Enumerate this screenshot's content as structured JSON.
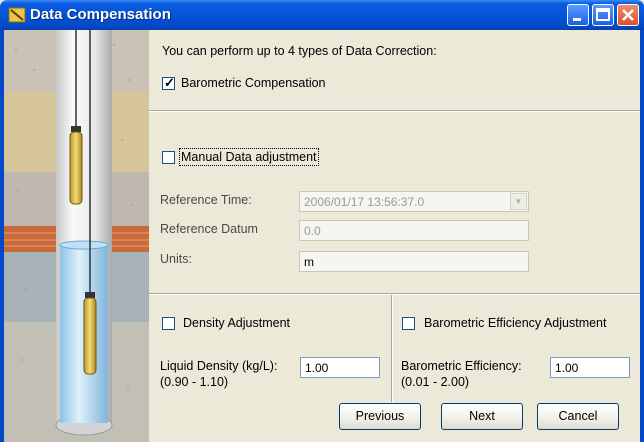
{
  "window": {
    "title": "Data Compensation"
  },
  "intro_text": "You can perform up to 4 types of Data Correction:",
  "barometric": {
    "label": "Barometric Compensation",
    "checked": true
  },
  "manual": {
    "label": "Manual Data adjustment",
    "checked": false,
    "reference_time_label": "Reference Time:",
    "reference_time_value": "2006/01/17 13:56:37.0",
    "reference_datum_label": "Reference Datum",
    "reference_datum_value": "0.0",
    "units_label": "Units:",
    "units_value": "m"
  },
  "density": {
    "label": "Density Adjustment",
    "checked": false,
    "liquid_density_label": "Liquid Density (kg/L):",
    "liquid_density_range": "(0.90 - 1.10)",
    "liquid_density_value": "1.00"
  },
  "efficiency": {
    "label": "Barometric Efficiency Adjustment",
    "checked": false,
    "value_label": "Barometric Efficiency:",
    "value_range": "(0.01 - 2.00)",
    "value": "1.00"
  },
  "buttons": {
    "previous": "Previous",
    "next": "Next",
    "cancel": "Cancel"
  },
  "check_mark": "✓",
  "dropdown_arrow": "▼"
}
